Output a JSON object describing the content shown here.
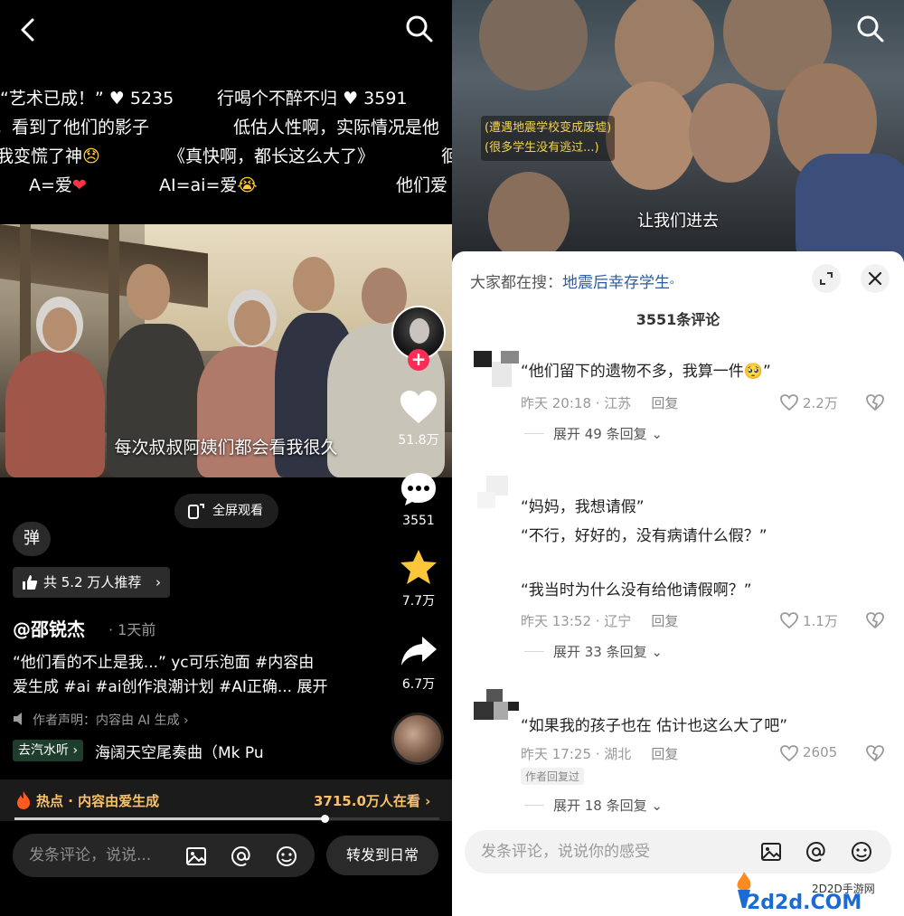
{
  "left": {
    "danmaku": [
      {
        "text": "“艺术已成！”",
        "likes": "5235"
      },
      {
        "text": "行喝个不醉不归",
        "likes": "3591"
      },
      {
        "text": "，看到了他们的影子"
      },
      {
        "text": "低估人性啊，实际情况是他"
      },
      {
        "text": "我变慌了神"
      },
      {
        "text": "《真快啊，都长这么大了》"
      },
      {
        "text": "徊"
      },
      {
        "text": "A=爱"
      },
      {
        "text": "AI=ai=爱"
      },
      {
        "text": "他们爱"
      }
    ],
    "video_subtitle": "每次叔叔阿姨们都会看我很久",
    "like_count": "51.8万",
    "comment_count": "3551",
    "favorite_count": "7.7万",
    "share_count": "6.7万",
    "fullscreen_label": "全屏观看",
    "danmu_label": "弹",
    "recommend_label": "共 5.2 万人推荐",
    "author": "@邵锐杰",
    "time": "· 1天前",
    "description_line1": "“他们看的不止是我...” yc可乐泡面 #内容由",
    "description_line2": "爱生成 #ai #ai创作浪潮计划 #AI正确...",
    "expand_label": "展开",
    "declaration": "作者声明：内容由 AI 生成",
    "music_tag": "去汽水听",
    "music_name": "海阔天空尾奏曲（Mk Pu",
    "hot_label": "热点 · 内容由爱生成",
    "viewers": "3715.0万人在看",
    "progress": 0.73,
    "input_placeholder": "发条评论，说说...",
    "forward_label": "转发到日常"
  },
  "right": {
    "caption_line1": "(遭遇地震学校变成废墟)",
    "caption_line2": "(很多学生没有逃过...)",
    "video_subtitle": "让我们进去",
    "everyone_searching": "大家都在搜：",
    "search_keyword": "地震后幸存学生",
    "comment_total": "3551条评论",
    "comments": [
      {
        "lines": [
          "“他们留下的遗物不多，我算一件🥺”"
        ],
        "time": "昨天 20:18 · 江苏",
        "reply": "回复",
        "likes": "2.2万",
        "expand": "展开 49 条回复"
      },
      {
        "lines": [
          "“妈妈，我想请假”",
          "“不行，好好的，没有病请什么假？”",
          "",
          "“我当时为什么没有给他请假啊？”"
        ],
        "time": "昨天 13:52 · 辽宁",
        "reply": "回复",
        "likes": "1.1万",
        "expand": "展开 33 条回复"
      },
      {
        "lines": [
          "“如果我的孩子也在 估计也这么大了吧”"
        ],
        "time": "昨天 17:25 · 湖北",
        "reply": "回复",
        "likes": "2605",
        "author_replied": "作者回复过",
        "expand": "展开 18 条回复"
      }
    ],
    "input_placeholder": "发条评论，说说你的感受"
  },
  "watermark": {
    "site": "2D2D手游网",
    "domain": "2d2d.COM"
  },
  "colors": {
    "accent_pink": "#fe2c55",
    "star_yellow": "#fdc53a",
    "hot_orange": "#f9c268",
    "keyword_blue": "#2c5aa0"
  }
}
